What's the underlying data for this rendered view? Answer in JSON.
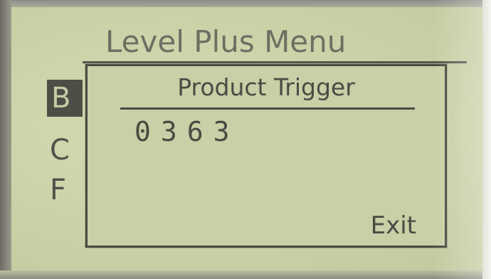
{
  "background_menu": {
    "title": "Level Plus Menu",
    "items": [
      "B",
      "C",
      "F"
    ],
    "selected_item": "B"
  },
  "popup": {
    "title": "Product Trigger",
    "value": "0363",
    "exit_label": "Exit"
  },
  "colors": {
    "lcd_background": "#c9cfa6",
    "lcd_foreground": "#4a4b43"
  }
}
